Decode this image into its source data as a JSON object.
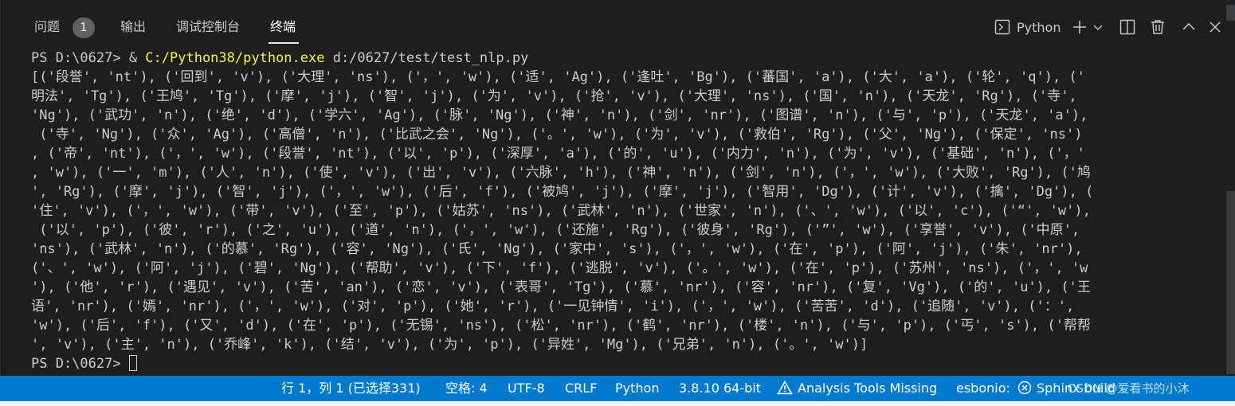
{
  "tabs": {
    "problems_label": "问题",
    "problems_count": "1",
    "output_label": "输出",
    "debug_console_label": "调试控制台",
    "terminal_label": "终端"
  },
  "actions": {
    "terminal_name": "Python",
    "icons": [
      "terminal-icon",
      "plus-icon",
      "chevron-down-icon",
      "split-icon",
      "trash-icon",
      "chevron-up-icon",
      "close-icon"
    ]
  },
  "terminal": {
    "lines": [
      "PS D:\\0627> & ",
      "[('段誉', 'nt'), ('回到', 'v'), ('大理', 'ns'), ('，', 'w'), ('适', 'Ag'), ('逢吐', 'Bg'), ('蕃国', 'a'), ('大', 'a'), ('轮', 'q'), ('",
      "明法', 'Tg'), ('王鸠', 'Tg'), ('摩', 'j'), ('智', 'j'), ('为', 'v'), ('抢', 'v'), ('大理', 'ns'), ('国', 'n'), ('天龙', 'Rg'), ('寺',",
      "'Ng'), ('武功', 'n'), ('绝', 'd'), ('学六', 'Ag'), ('脉', 'Ng'), ('神', 'n'), ('剑', 'nr'), ('图谱', 'n'), ('与', 'p'), ('天龙', 'a'),",
      " ('寺', 'Ng'), ('众', 'Ag'), ('高僧', 'n'), ('比武之会', 'Ng'), ('。', 'w'), ('为', 'v'), ('救伯', 'Rg'), ('父', 'Ng'), ('保定', 'ns')",
      ", ('帝', 'nt'), ('，', 'w'), ('段誉', 'nt'), ('以', 'p'), ('深厚', 'a'), ('的', 'u'), ('内力', 'n'), ('为', 'v'), ('基础', 'n'), ('，'",
      ", 'w'), ('一', 'm'), ('人', 'n'), ('使', 'v'), ('出', 'v'), ('六脉', 'h'), ('神', 'n'), ('剑', 'n'), ('，', 'w'), ('大败', 'Rg'), ('鸠",
      "', 'Rg'), ('摩', 'j'), ('智', 'j'), ('，', 'w'), ('后', 'f'), ('被鸠', 'j'), ('摩', 'j'), ('智用', 'Dg'), ('计', 'v'), ('擒', 'Dg'), (",
      "'住', 'v'), ('，', 'w'), ('带', 'v'), ('至', 'p'), ('姑苏', 'ns'), ('武林', 'n'), ('世家', 'n'), ('、', 'w'), ('以', 'c'), ('“', 'w'),",
      " ('以', 'p'), ('彼', 'r'), ('之', 'u'), ('道', 'n'), ('，', 'w'), ('还施', 'Rg'), ('彼身', 'Rg'), ('”', 'w'), ('享誉', 'v'), ('中原',",
      "'ns'), ('武林', 'n'), ('的慕', 'Rg'), ('容', 'Ng'), ('氏', 'Ng'), ('家中', 's'), ('，', 'w'), ('在', 'p'), ('阿', 'j'), ('朱', 'nr'),",
      "('、', 'w'), ('阿', 'j'), ('碧', 'Ng'), ('帮助', 'v'), ('下', 'f'), ('逃脱', 'v'), ('。', 'w'), ('在', 'p'), ('苏州', 'ns'), ('，', 'w",
      "'), ('他', 'r'), ('遇见', 'v'), ('苦', 'an'), ('恋', 'v'), ('表哥', 'Tg'), ('慕', 'nr'), ('容', 'nr'), ('复', 'Vg'), ('的', 'u'), ('王",
      "语', 'nr'), ('嫣', 'nr'), ('，', 'w'), ('对', 'p'), ('她', 'r'), ('一见钟情', 'i'), ('，', 'w'), ('苦苦', 'd'), ('追随', 'v'), ('：',",
      "'w'), ('后', 'f'), ('又', 'd'), ('在', 'p'), ('无锡', 'ns'), ('松', 'nr'), ('鹤', 'nr'), ('楼', 'n'), ('与', 'p'), ('丐', 's'), ('帮帮",
      "', 'v'), ('主', 'n'), ('乔峰', 'k'), ('结', 'v'), ('为', 'p'), ('异姓', 'Mg'), ('兄弟', 'n'), ('。', 'w')]",
      "PS D:\\0627> "
    ],
    "command_exe": "C:/Python38/python.exe",
    "command_arg": " d:/0627/test/test_nlp.py"
  },
  "status": {
    "selection": "行 1，列 1 (已选择331)",
    "spaces": "空格: 4",
    "encoding": "UTF-8",
    "eol": "CRLF",
    "language": "Python",
    "interpreter": "3.8.10 64-bit",
    "analysis": "Analysis Tools Missing",
    "esbonio": "esbonio:",
    "sphinx": "Sphinx build",
    "watermark": "CSDN @爱看书的小沐"
  },
  "colors": {
    "status_bg": "#007acc",
    "panel_bg": "#1e1e1e",
    "command_highlight": "#f5f543"
  }
}
